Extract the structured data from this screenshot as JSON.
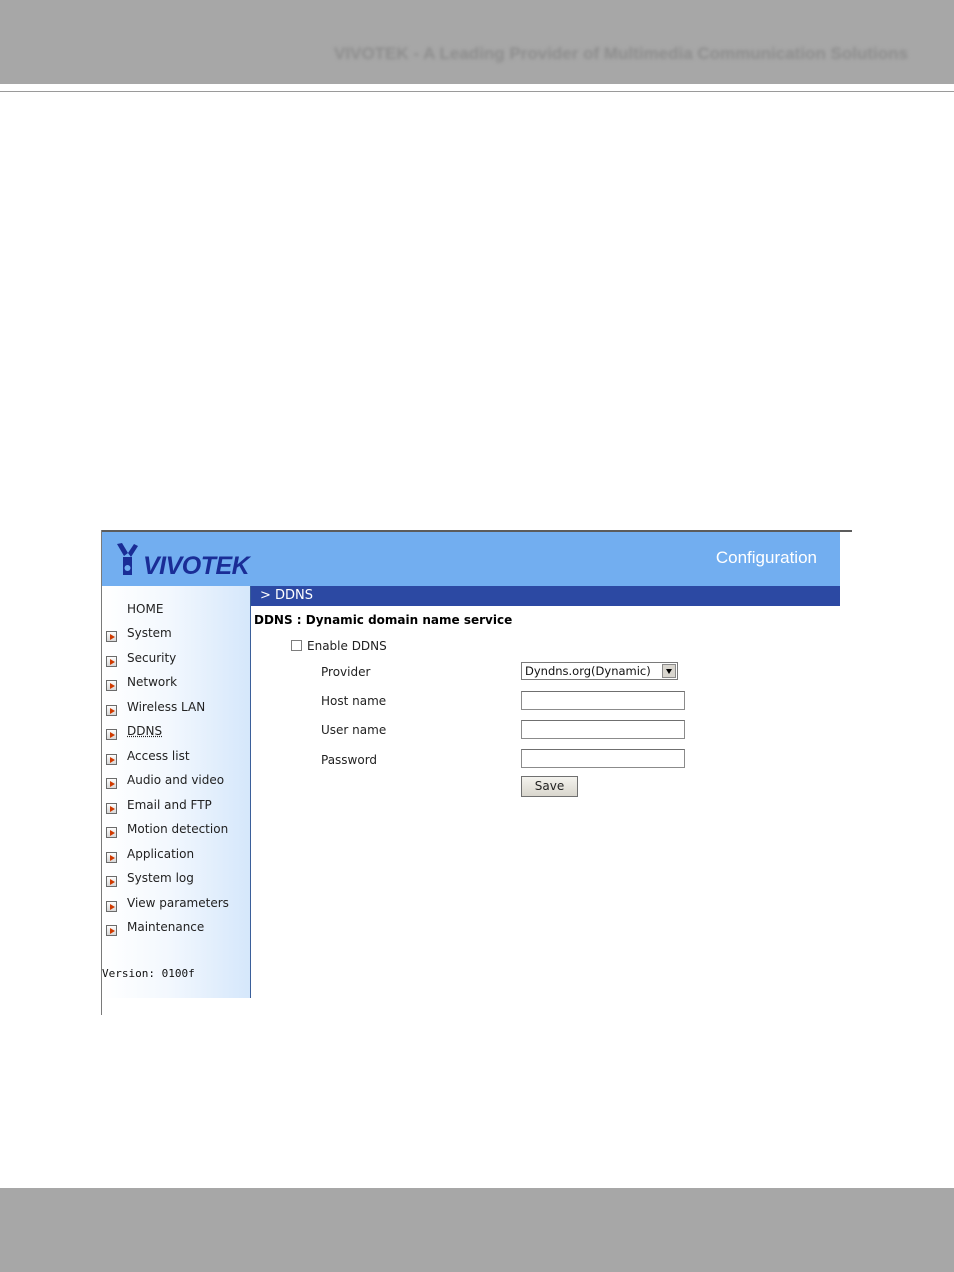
{
  "page": {
    "header_text": "VIVOTEK - A Leading Provider of Multimedia Communication Solutions"
  },
  "banner": {
    "logo_text": "VIVOTEK",
    "title": "Configuration"
  },
  "sidebar": {
    "items": [
      {
        "label": "HOME",
        "icon": ""
      },
      {
        "label": "System",
        "icon": "arrow-icon"
      },
      {
        "label": "Security",
        "icon": "arrow-icon"
      },
      {
        "label": "Network",
        "icon": "arrow-icon"
      },
      {
        "label": "Wireless LAN",
        "icon": "arrow-icon"
      },
      {
        "label": "DDNS",
        "icon": "arrow-icon",
        "active": true
      },
      {
        "label": "Access list",
        "icon": "arrow-icon"
      },
      {
        "label": "Audio and video",
        "icon": "arrow-icon"
      },
      {
        "label": "Email and FTP",
        "icon": "arrow-icon"
      },
      {
        "label": "Motion detection",
        "icon": "arrow-icon"
      },
      {
        "label": "Application",
        "icon": "arrow-icon"
      },
      {
        "label": "System log",
        "icon": "arrow-icon"
      },
      {
        "label": "View parameters",
        "icon": "arrow-icon"
      },
      {
        "label": "Maintenance",
        "icon": "arrow-icon"
      }
    ],
    "version": "Version: 0100f"
  },
  "content": {
    "path": "> DDNS",
    "section_title": "DDNS : Dynamic domain name service",
    "enable_label": "Enable DDNS",
    "enable_checked": false,
    "provider_label": "Provider",
    "provider_value": "Dyndns.org(Dynamic)",
    "host_label": "Host name",
    "host_value": "",
    "user_label": "User name",
    "user_value": "",
    "password_label": "Password",
    "password_value": "",
    "save_label": "Save"
  },
  "colors": {
    "banner": "#72aef0",
    "path_bar": "#2c49a3",
    "logo": "#1a2d96",
    "page_band": "#a7a7a7"
  }
}
